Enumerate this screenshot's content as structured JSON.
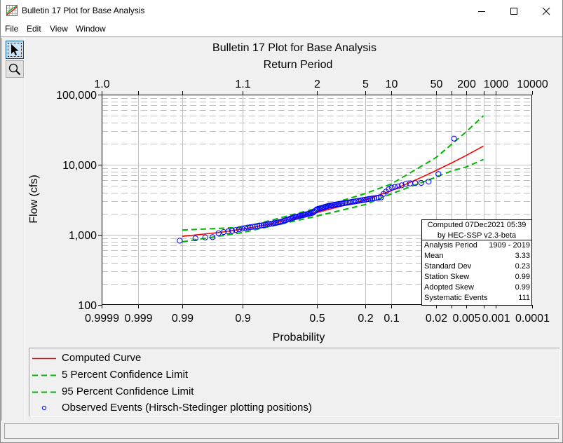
{
  "window": {
    "title": "Bulletin 17 Plot for Base Analysis",
    "app_icon": "frequency-chart-icon",
    "controls": [
      {
        "name": "minimize",
        "icon": "minimize-icon"
      },
      {
        "name": "maximize",
        "icon": "maximize-icon"
      },
      {
        "name": "close",
        "icon": "close-icon"
      }
    ]
  },
  "menu": {
    "items": [
      "File",
      "Edit",
      "View",
      "Window"
    ]
  },
  "toolbar": {
    "tools": [
      {
        "icon": "arrow-pointer-icon",
        "selected": true
      },
      {
        "icon": "magnifier-icon",
        "selected": false
      }
    ]
  },
  "chart_data": {
    "type": "line",
    "title": "Bulletin 17 Plot for Base Analysis",
    "top_axis_label": "Return Period",
    "xlabel": "Probability",
    "ylabel": "Flow (cfs)",
    "x_scale": "normal probability (exceedance)",
    "y_scale": "log",
    "xlim": [
      0.9999,
      0.0001
    ],
    "ylim": [
      100,
      100000
    ],
    "grid": true,
    "x_gridlines": [
      0.999,
      0.99,
      0.9,
      0.5,
      0.2,
      0.1,
      0.02,
      0.01,
      0.005,
      0.002,
      0.001
    ],
    "x_ticks": [
      {
        "p": 0.9999,
        "label": "0.9999"
      },
      {
        "p": 0.999,
        "label": "0.999"
      },
      {
        "p": 0.99,
        "label": "0.99"
      },
      {
        "p": 0.9,
        "label": "0.9"
      },
      {
        "p": 0.5,
        "label": "0.5"
      },
      {
        "p": 0.2,
        "label": "0.2"
      },
      {
        "p": 0.1,
        "label": "0.1"
      },
      {
        "p": 0.02,
        "label": "0.02"
      },
      {
        "p": 0.01,
        "label": ""
      },
      {
        "p": 0.005,
        "label": "0.005"
      },
      {
        "p": 0.002,
        "label": ""
      },
      {
        "p": 0.001,
        "label": "0.001"
      },
      {
        "p": 0.0001,
        "label": "0.0001"
      }
    ],
    "top_ticks": [
      {
        "p": 0.9999,
        "label": "1.0"
      },
      {
        "p": 0.999,
        "label": ""
      },
      {
        "p": 0.99,
        "label": ""
      },
      {
        "p": 0.9,
        "label": "1.1"
      },
      {
        "p": 0.5,
        "label": "2"
      },
      {
        "p": 0.2,
        "label": "5"
      },
      {
        "p": 0.1,
        "label": "10"
      },
      {
        "p": 0.02,
        "label": "50"
      },
      {
        "p": 0.01,
        "label": ""
      },
      {
        "p": 0.005,
        "label": "200"
      },
      {
        "p": 0.002,
        "label": ""
      },
      {
        "p": 0.001,
        "label": "1000"
      },
      {
        "p": 0.0001,
        "label": "10000"
      }
    ],
    "y_ticks": [
      {
        "value": 100,
        "label": "100"
      },
      {
        "value": 1000,
        "label": "1,000"
      },
      {
        "value": 10000,
        "label": "10,000"
      },
      {
        "value": 100000,
        "label": "100,000"
      }
    ],
    "series": [
      {
        "name": "Computed Curve",
        "kind": "line",
        "color": "#ff0000",
        "dash": "solid",
        "probability": [
          0.99,
          0.95,
          0.9,
          0.8,
          0.5,
          0.2,
          0.1,
          0.04,
          0.02,
          0.01,
          0.005,
          0.002
        ],
        "flow": [
          950,
          1090,
          1210,
          1400,
          2080,
          3160,
          4250,
          6300,
          8230,
          10600,
          13500,
          18500
        ]
      },
      {
        "name": "5 Percent Confidence Limit",
        "kind": "line",
        "color": "#00b400",
        "dash": "dashed",
        "probability": [
          0.99,
          0.95,
          0.9,
          0.8,
          0.5,
          0.2,
          0.1,
          0.04,
          0.02,
          0.01,
          0.005,
          0.002
        ],
        "flow": [
          1170,
          1240,
          1280,
          1570,
          2400,
          3890,
          5300,
          8950,
          12600,
          19500,
          29300,
          50100
        ]
      },
      {
        "name": "95 Percent Confidence Limit",
        "kind": "line",
        "color": "#00b400",
        "dash": "dashed",
        "probability": [
          0.99,
          0.95,
          0.9,
          0.8,
          0.5,
          0.2,
          0.1,
          0.04,
          0.02,
          0.01,
          0.005,
          0.002
        ],
        "flow": [
          794,
          970,
          1080,
          1300,
          1850,
          2710,
          3830,
          5350,
          6640,
          8130,
          9270,
          11900
        ]
      },
      {
        "name": "Observed Events (Hirsch-Stedinger plotting positions)",
        "kind": "scatter",
        "color": "#0000ff",
        "marker": "circle",
        "points": [
          [
            0.0089,
            23600
          ],
          [
            0.0179,
            7360
          ],
          [
            0.0268,
            5750
          ],
          [
            0.0357,
            5500
          ],
          [
            0.0446,
            5470
          ],
          [
            0.0536,
            5410
          ],
          [
            0.0625,
            5330
          ],
          [
            0.0714,
            5090
          ],
          [
            0.0804,
            4900
          ],
          [
            0.0893,
            4820
          ],
          [
            0.0982,
            4710
          ],
          [
            0.1071,
            4470
          ],
          [
            0.1161,
            4140
          ],
          [
            0.125,
            3830
          ],
          [
            0.1339,
            3410
          ],
          [
            0.1429,
            3395
          ],
          [
            0.1518,
            3360
          ],
          [
            0.1607,
            3330
          ],
          [
            0.1696,
            3300
          ],
          [
            0.1786,
            3270
          ],
          [
            0.1875,
            3230
          ],
          [
            0.1964,
            3190
          ],
          [
            0.2054,
            3160
          ],
          [
            0.2143,
            3130
          ],
          [
            0.2232,
            3100
          ],
          [
            0.2321,
            3070
          ],
          [
            0.2411,
            3040
          ],
          [
            0.25,
            3010
          ],
          [
            0.2589,
            2985
          ],
          [
            0.2679,
            2965
          ],
          [
            0.2768,
            2940
          ],
          [
            0.2857,
            2910
          ],
          [
            0.2946,
            2890
          ],
          [
            0.3036,
            2865
          ],
          [
            0.3125,
            2845
          ],
          [
            0.3214,
            2820
          ],
          [
            0.3304,
            2800
          ],
          [
            0.3393,
            2780
          ],
          [
            0.3482,
            2755
          ],
          [
            0.3571,
            2735
          ],
          [
            0.3661,
            2715
          ],
          [
            0.375,
            2700
          ],
          [
            0.3839,
            2680
          ],
          [
            0.3929,
            2655
          ],
          [
            0.4018,
            2635
          ],
          [
            0.4107,
            2620
          ],
          [
            0.4196,
            2595
          ],
          [
            0.4286,
            2560
          ],
          [
            0.4375,
            2530
          ],
          [
            0.4464,
            2495
          ],
          [
            0.4554,
            2465
          ],
          [
            0.4643,
            2430
          ],
          [
            0.4732,
            2405
          ],
          [
            0.4821,
            2375
          ],
          [
            0.4911,
            2345
          ],
          [
            0.5,
            2315
          ],
          [
            0.5089,
            2230
          ],
          [
            0.5179,
            2140
          ],
          [
            0.5268,
            2070
          ],
          [
            0.5357,
            2045
          ],
          [
            0.5446,
            2030
          ],
          [
            0.5536,
            2005
          ],
          [
            0.5625,
            1980
          ],
          [
            0.5714,
            1965
          ],
          [
            0.5804,
            1940
          ],
          [
            0.5893,
            1920
          ],
          [
            0.5982,
            1900
          ],
          [
            0.6071,
            1880
          ],
          [
            0.6161,
            1860
          ],
          [
            0.625,
            1835
          ],
          [
            0.6339,
            1815
          ],
          [
            0.6429,
            1795
          ],
          [
            0.6518,
            1775
          ],
          [
            0.6607,
            1750
          ],
          [
            0.6696,
            1720
          ],
          [
            0.6786,
            1695
          ],
          [
            0.6875,
            1665
          ],
          [
            0.6964,
            1640
          ],
          [
            0.7054,
            1615
          ],
          [
            0.7143,
            1590
          ],
          [
            0.7232,
            1560
          ],
          [
            0.7321,
            1535
          ],
          [
            0.7411,
            1515
          ],
          [
            0.75,
            1500
          ],
          [
            0.7589,
            1485
          ],
          [
            0.7679,
            1470
          ],
          [
            0.7768,
            1455
          ],
          [
            0.7857,
            1440
          ],
          [
            0.7946,
            1425
          ],
          [
            0.8036,
            1410
          ],
          [
            0.8125,
            1395
          ],
          [
            0.8214,
            1375
          ],
          [
            0.8304,
            1360
          ],
          [
            0.8393,
            1345
          ],
          [
            0.8482,
            1330
          ],
          [
            0.8571,
            1315
          ],
          [
            0.8661,
            1300
          ],
          [
            0.875,
            1285
          ],
          [
            0.8839,
            1270
          ],
          [
            0.8929,
            1250
          ],
          [
            0.9018,
            1230
          ],
          [
            0.9107,
            1200
          ],
          [
            0.9196,
            1170
          ],
          [
            0.9286,
            1140
          ],
          [
            0.9375,
            1120
          ],
          [
            0.9464,
            1095
          ],
          [
            0.9554,
            1055
          ],
          [
            0.9643,
            927
          ],
          [
            0.9732,
            918
          ],
          [
            0.9821,
            890
          ],
          [
            0.9911,
            825
          ]
        ]
      }
    ],
    "legend": {
      "position": "bottom",
      "entries": [
        {
          "label": "Computed Curve",
          "series": 0
        },
        {
          "label": "5 Percent Confidence Limit",
          "series": 1
        },
        {
          "label": "95 Percent Confidence Limit",
          "series": 2
        },
        {
          "label": "Observed Events (Hirsch-Stedinger plotting positions)",
          "series": 3
        }
      ]
    },
    "stats_box": {
      "position": "bottom-right",
      "header": [
        "Computed 07Dec2021 05:39",
        "by HEC-SSP v2.3-beta"
      ],
      "rows": [
        {
          "label": "Analysis Period",
          "value": "1909 - 2019"
        },
        {
          "label": "Mean",
          "value": "3.33"
        },
        {
          "label": "Standard Dev",
          "value": "0.23"
        },
        {
          "label": "Station Skew",
          "value": "0.99"
        },
        {
          "label": "Adopted Skew",
          "value": "0.99"
        },
        {
          "label": "Systematic Events",
          "value": "111"
        }
      ]
    }
  },
  "status_bar": {
    "text": ""
  }
}
